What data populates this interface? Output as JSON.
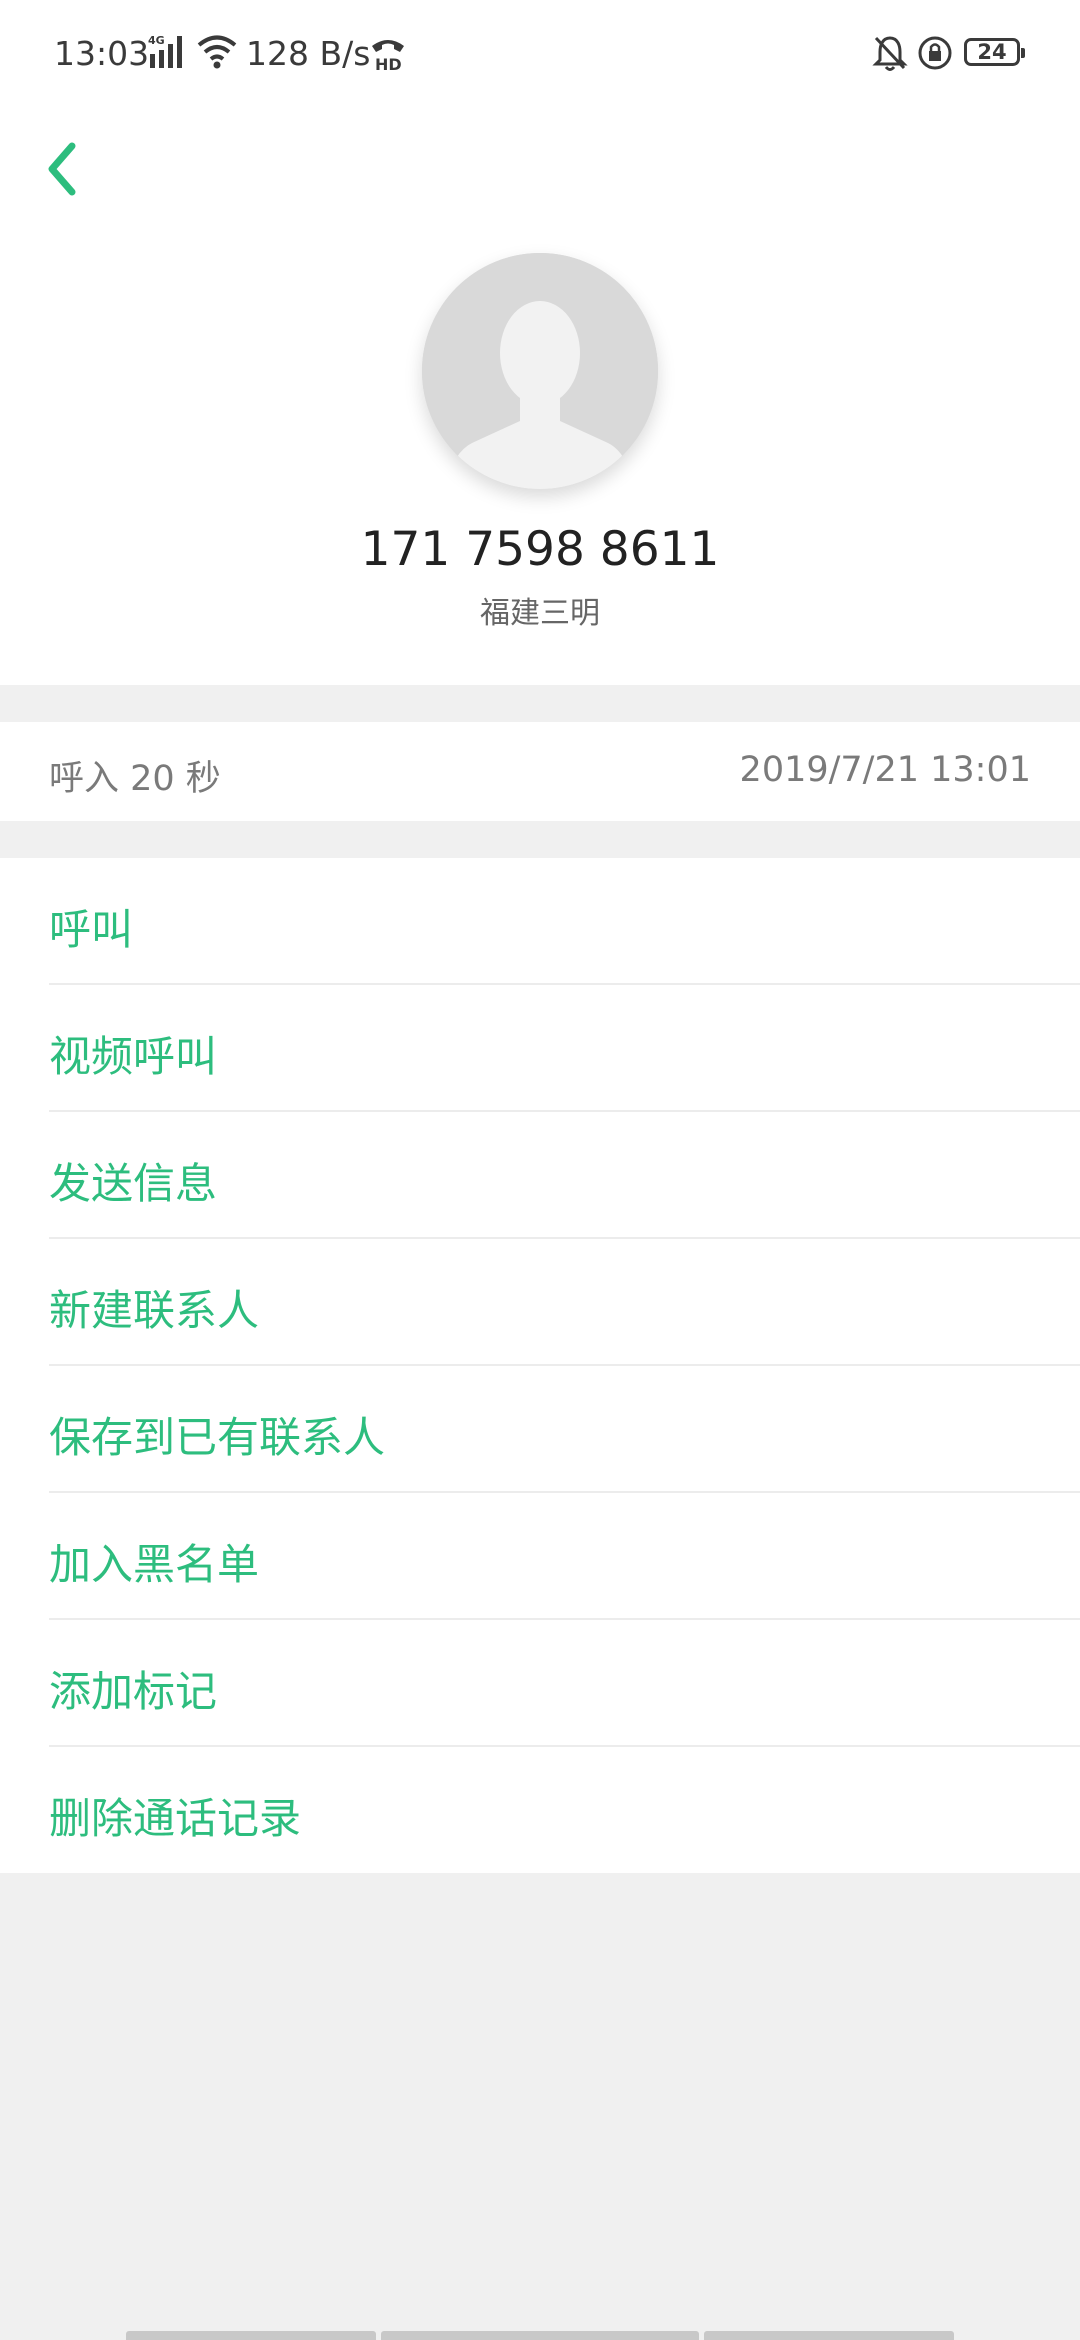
{
  "status_bar": {
    "time": "13:03",
    "network_type": "4G",
    "speed": "128 B/s",
    "hd_label": "HD",
    "battery": "24",
    "icons": [
      "signal-icon",
      "wifi-icon",
      "hd-call-icon",
      "mute-bell-icon",
      "rotation-lock-icon",
      "battery-icon"
    ]
  },
  "contact": {
    "phone": "171 7598 8611",
    "location": "福建三明"
  },
  "call_info": {
    "type_duration": "呼入  20 秒",
    "datetime": "2019/7/21 13:01"
  },
  "actions": [
    {
      "label": "呼叫"
    },
    {
      "label": "视频呼叫"
    },
    {
      "label": "发送信息"
    },
    {
      "label": "新建联系人"
    },
    {
      "label": "保存到已有联系人"
    },
    {
      "label": "加入黑名单"
    },
    {
      "label": "添加标记"
    },
    {
      "label": "删除通话记录"
    }
  ],
  "colors": {
    "accent": "#2dbd7e",
    "background": "#f0f0f0",
    "card": "#ffffff"
  }
}
